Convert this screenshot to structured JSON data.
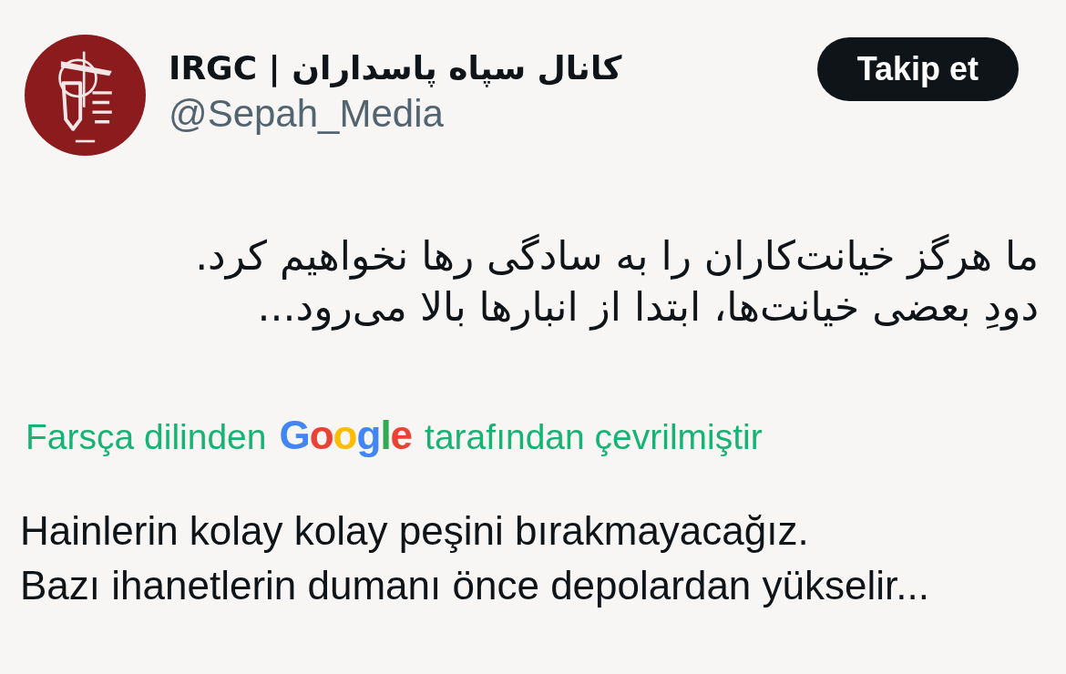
{
  "tweet": {
    "author": {
      "name": "IRGC | كانال سپاه پاسداران",
      "handle": "@Sepah_Media"
    },
    "follow_button": "Takip et",
    "text_lines": [
      "ما هرگز خیانت‌کاران را به سادگی رها نخواهیم کرد.",
      "دودِ بعضی خیانت‌ها، ابتدا از انبارها بالا می‌رود..."
    ],
    "translation_note": {
      "before": "Farsça dilinden",
      "logo": "Google",
      "after": "tarafından çevrilmiştir"
    },
    "translated_lines": [
      "Hainlerin kolay kolay peşini bırakmayacağız.",
      "Bazı ihanetlerin dumanı önce depolardan yükselir..."
    ]
  }
}
